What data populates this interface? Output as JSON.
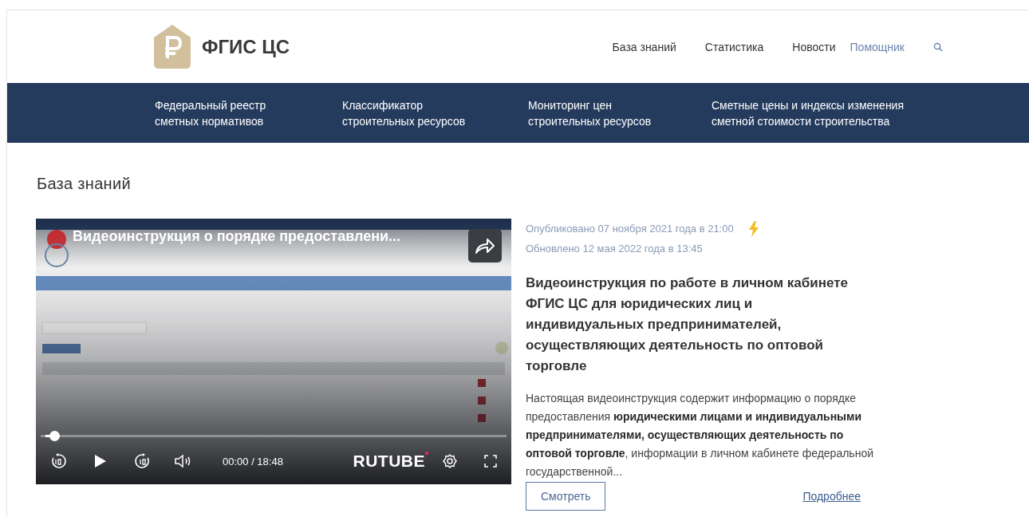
{
  "header": {
    "logo_text": "ФГИС ЦС",
    "nav": [
      {
        "label": "База знаний",
        "kind": "link"
      },
      {
        "label": "Статистика",
        "kind": "link"
      },
      {
        "label": "Новости",
        "kind": "link"
      },
      {
        "label": "Помощник",
        "kind": "accent"
      }
    ]
  },
  "menu": [
    {
      "label": "Федеральный реестр сметных нормативов"
    },
    {
      "label": "Классификатор строительных ресурсов"
    },
    {
      "label": "Мониторинг цен строительных ресурсов"
    },
    {
      "label": "Сметные цены и индексы изменения сметной стоимости строительства"
    }
  ],
  "page_title": "База знаний",
  "video": {
    "kind": "picture",
    "title": "Видеоинструкция о порядке предоставлени...",
    "time": "00:00 / 18:48",
    "brand": "RUTUBE",
    "level": 0.02
  },
  "article": {
    "published": "Опубликовано 07 ноября 2021 года в 21:00",
    "updated": "Обновлено 12 мая 2022 года в 13:45",
    "title": "Видеоинструкция по работе в личном кабинете ФГИС ЦС для юридических лиц и индивидуальных предпринимателей, осуществляющих деятельность по оптовой торговле",
    "description": "Настоящая видеоинструкция содержит информацию о порядке предоставления **юридическими лицами и индивидуальными предпринимателями, осуществляющих деятельность по оптовой торговле**, информации в личном кабинете федеральной государственной...",
    "watch_button": "Смотреть",
    "more_link": "Подробнее"
  }
}
